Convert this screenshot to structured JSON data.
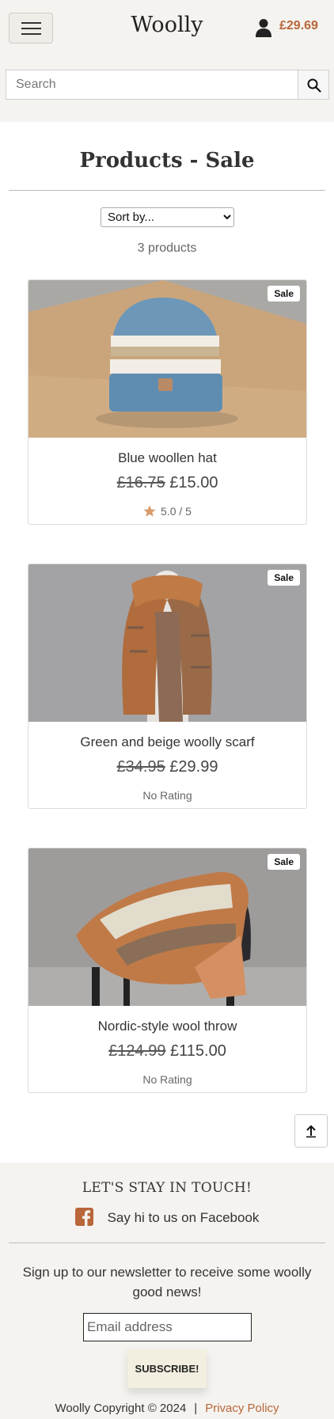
{
  "header": {
    "brand": "Woolly",
    "cart_total": "£29.69",
    "search": {
      "placeholder": "Search"
    }
  },
  "main": {
    "title": "Products - Sale",
    "sort": {
      "selected": "Sort by..."
    },
    "product_count": "3 products",
    "products": [
      {
        "name": "Blue woollen hat",
        "old_price": "£16.75",
        "price": "£15.00",
        "rating": "5.0 / 5",
        "badge": "Sale"
      },
      {
        "name": "Green and beige woolly scarf",
        "old_price": "£34.95",
        "price": "£29.99",
        "rating": "No Rating",
        "badge": "Sale"
      },
      {
        "name": "Nordic-style wool throw",
        "old_price": "£124.99",
        "price": "£115.00",
        "rating": "No Rating",
        "badge": "Sale"
      }
    ]
  },
  "footer": {
    "stay_title": "LET'S STAY IN TOUCH!",
    "facebook_text": "Say hi to us on Facebook",
    "newsletter_text": "Sign up to our newsletter to receive some woolly good news!",
    "email_placeholder": "Email address",
    "subscribe_label": "SUBSCRIBE!",
    "copyright": "Woolly Copyright © 2024",
    "separator": "|",
    "privacy_label": "Privacy Policy"
  },
  "colors": {
    "accent": "#b8663a",
    "header_bg": "#f5f3ef",
    "subscribe_bg": "#f2efe0"
  },
  "icons": [
    "menu-icon",
    "account-icon",
    "search-icon",
    "star-icon",
    "arrow-up-icon",
    "facebook-icon"
  ]
}
